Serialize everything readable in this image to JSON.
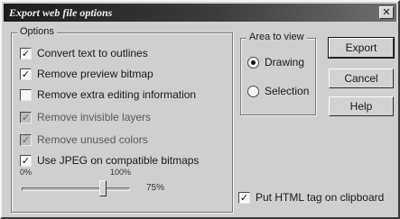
{
  "window": {
    "title": "Export web file options",
    "close_glyph": "✕"
  },
  "options_group": {
    "label": "Options",
    "items": [
      {
        "label": "Convert text to outlines",
        "checked": true,
        "enabled": true
      },
      {
        "label": "Remove preview bitmap",
        "checked": true,
        "enabled": true
      },
      {
        "label": "Remove extra editing information",
        "checked": false,
        "enabled": true
      },
      {
        "label": "Remove invisible layers",
        "checked": true,
        "enabled": false
      },
      {
        "label": "Remove unused colors",
        "checked": true,
        "enabled": false
      },
      {
        "label": "Use JPEG on compatible bitmaps",
        "checked": true,
        "enabled": true
      }
    ],
    "quality": {
      "min_label": "0%",
      "max_label": "100%",
      "value_label": "75%",
      "value": 75
    }
  },
  "area_group": {
    "label": "Area to view",
    "options": [
      {
        "label": "Drawing",
        "selected": true
      },
      {
        "label": "Selection",
        "selected": false
      }
    ]
  },
  "buttons": {
    "export": "Export",
    "cancel": "Cancel",
    "help": "Help"
  },
  "clipboard_option": {
    "label": "Put HTML tag on clipboard",
    "checked": true
  },
  "check_glyph": "✓"
}
